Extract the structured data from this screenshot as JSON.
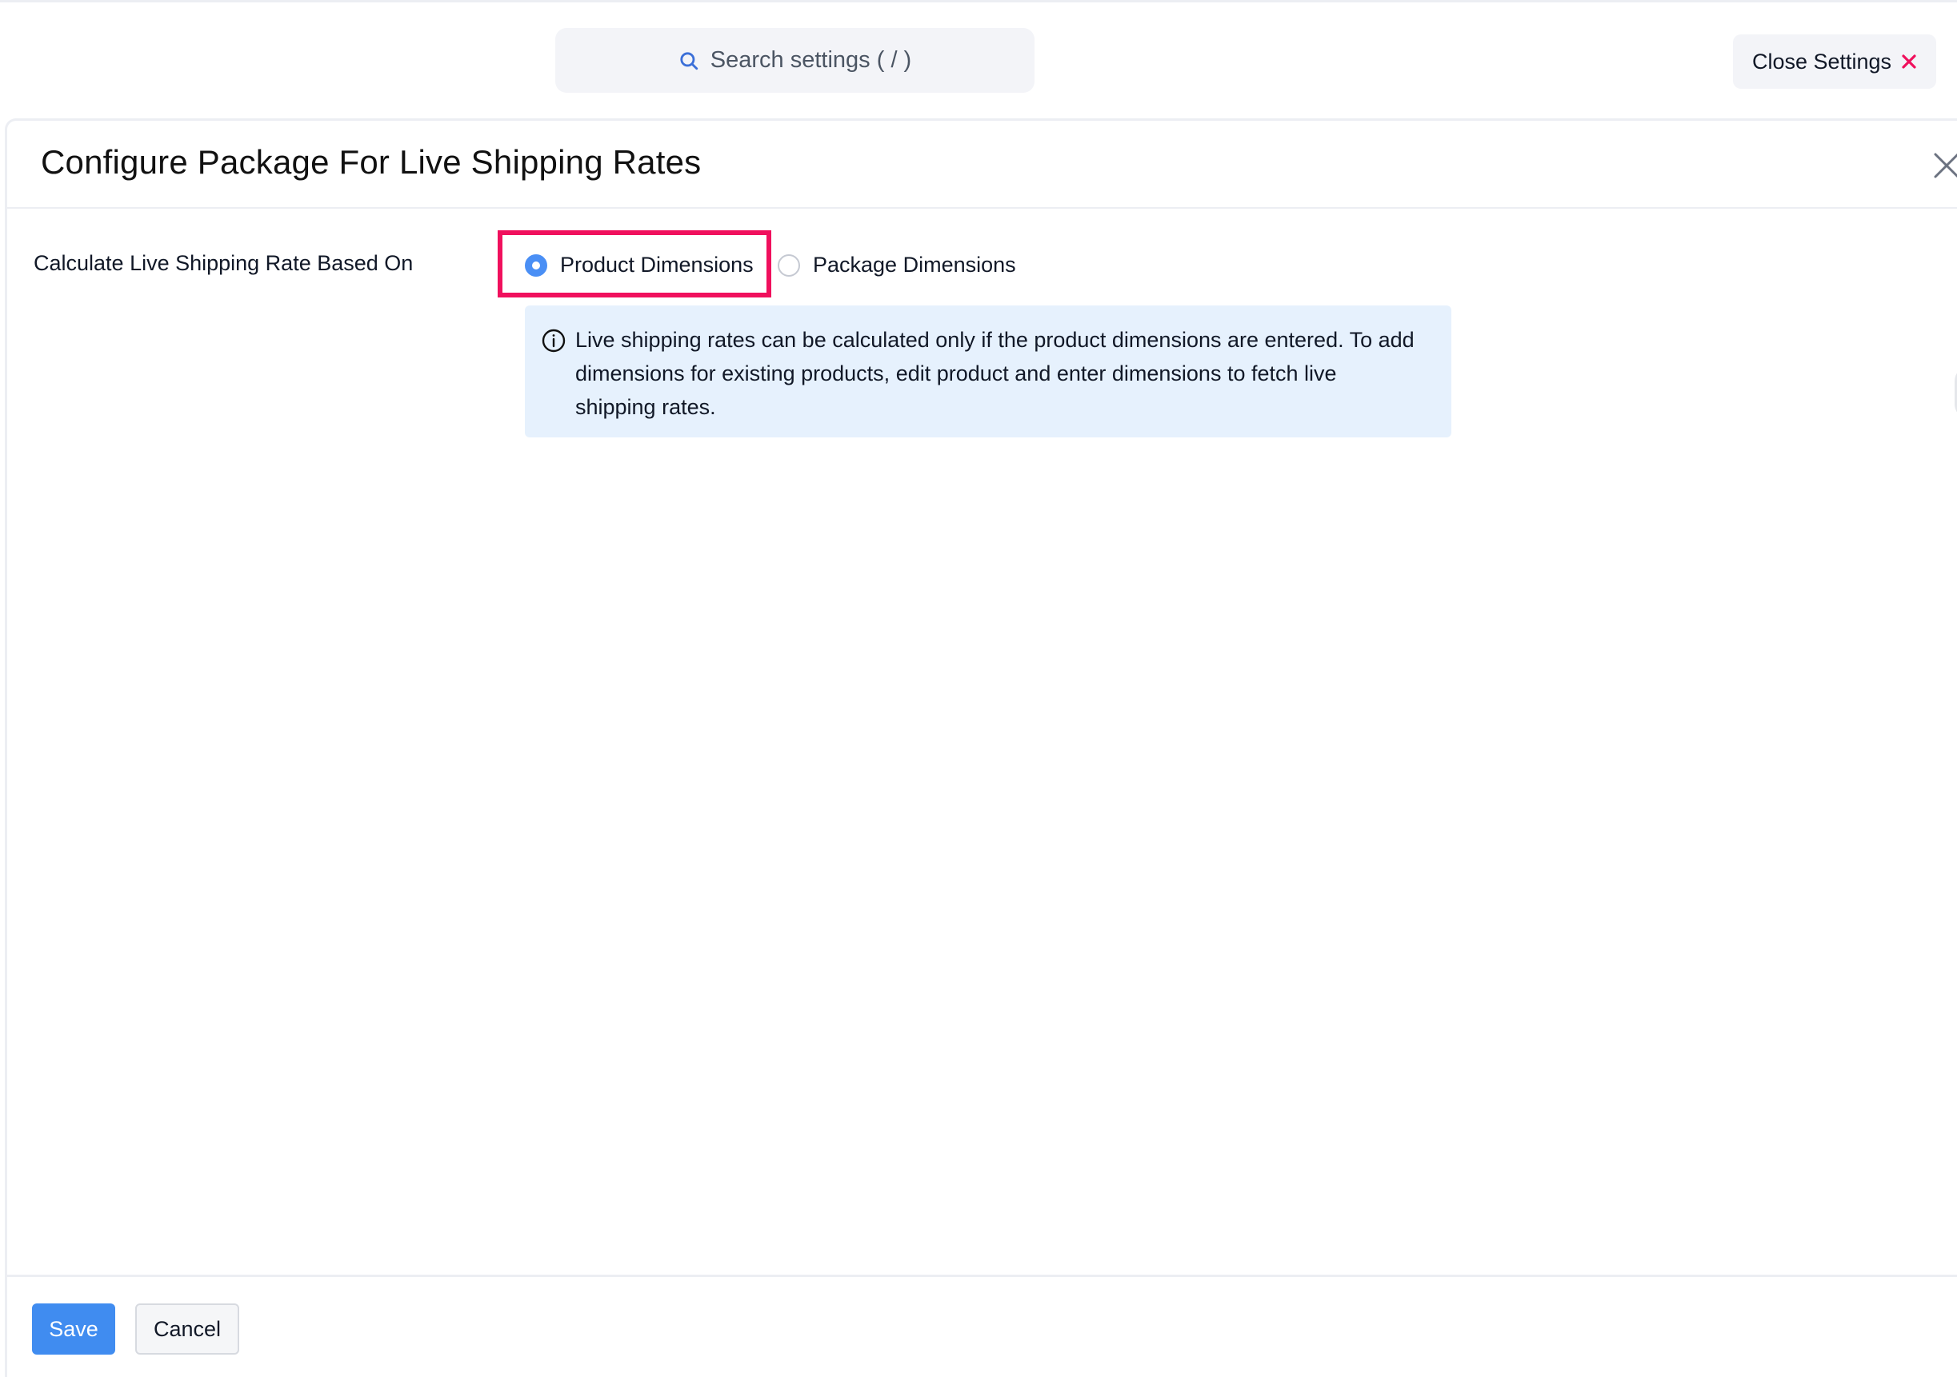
{
  "topbar": {
    "search_placeholder": "Search settings ( / )",
    "search_icon": "search-icon",
    "close_settings_label": "Close Settings",
    "close_settings_icon": "close-icon",
    "close_settings_icon_color": "#f0105d"
  },
  "panel": {
    "title": "Configure Package For Live Shipping Rates",
    "close_icon": "close-icon"
  },
  "form": {
    "rate_basis_label": "Calculate Live Shipping Rate Based On",
    "options": [
      {
        "label": "Product Dimensions",
        "selected": true
      },
      {
        "label": "Package Dimensions",
        "selected": false
      }
    ],
    "info_text": "Live shipping rates can be calculated only if the product dimensions are entered. To add dimensions for existing products, edit product and enter dimensions to fetch live shipping rates.",
    "info_icon": "info-icon"
  },
  "footer": {
    "save_label": "Save",
    "cancel_label": "Cancel"
  },
  "colors": {
    "accent": "#408cf0",
    "highlight": "#f0105d",
    "info_background": "#e6f1fd"
  }
}
